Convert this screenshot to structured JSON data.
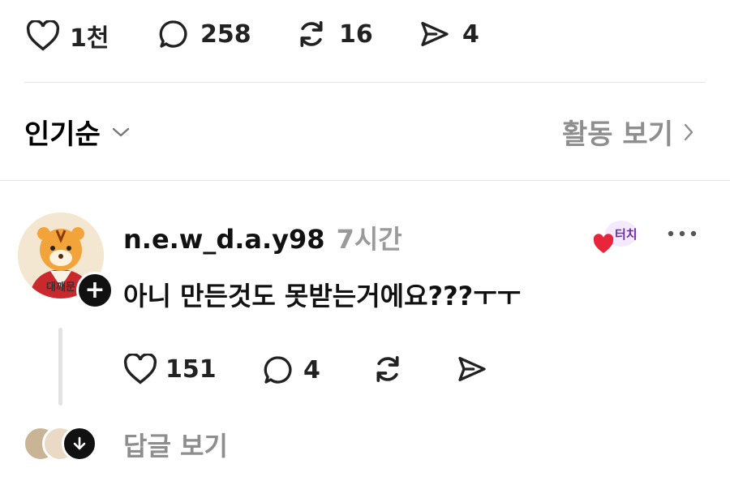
{
  "post_stats": {
    "likes": "1천",
    "comments": "258",
    "reposts": "16",
    "shares": "4"
  },
  "sort_bar": {
    "sort_label": "인기순",
    "activity_label": "활동 보기"
  },
  "reply": {
    "username": "n.e.w_d.a.y98",
    "time": "7시간",
    "avatar_caption": "대깨문",
    "badge_text": "터치",
    "text": "아니 만든것도 못받는거에요???ㅜㅜ",
    "likes": "151",
    "comments": "4",
    "view_replies_label": "답글 보기"
  },
  "colors": {
    "text": "#111111",
    "muted": "#8e8e8e",
    "divider": "#e6e6e6",
    "heart_red": "#e8253b"
  },
  "icons": [
    "heart-icon",
    "comment-icon",
    "repost-icon",
    "share-icon",
    "chevron-down-icon",
    "chevron-right-icon",
    "plus-icon",
    "more-icon",
    "arrow-down-icon"
  ]
}
